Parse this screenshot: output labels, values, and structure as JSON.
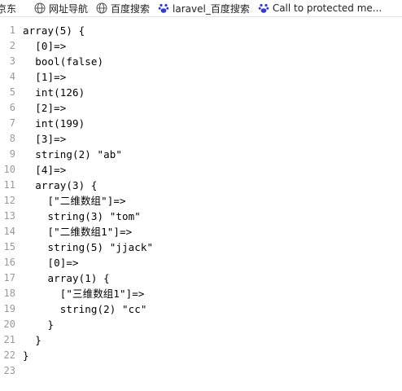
{
  "bookmarks": [
    {
      "label": "京东",
      "icon": "bookmark-icon"
    },
    {
      "label": "网址导航",
      "icon": "globe-icon"
    },
    {
      "label": "百度搜索",
      "icon": "globe-icon"
    },
    {
      "label": "laravel_百度搜索",
      "icon": "baidu-paw-icon"
    },
    {
      "label": "Call to protected me...",
      "icon": "baidu-paw-icon"
    }
  ],
  "code_lines": [
    {
      "n": "1",
      "text": "array(5) {"
    },
    {
      "n": "2",
      "text": "  [0]=>"
    },
    {
      "n": "3",
      "text": "  bool(false)"
    },
    {
      "n": "4",
      "text": "  [1]=>"
    },
    {
      "n": "5",
      "text": "  int(126)"
    },
    {
      "n": "6",
      "text": "  [2]=>"
    },
    {
      "n": "7",
      "text": "  int(199)"
    },
    {
      "n": "8",
      "text": "  [3]=>"
    },
    {
      "n": "9",
      "text": "  string(2) \"ab\""
    },
    {
      "n": "10",
      "text": "  [4]=>"
    },
    {
      "n": "11",
      "text": "  array(3) {"
    },
    {
      "n": "12",
      "text": "    [\"二维数组\"]=>"
    },
    {
      "n": "13",
      "text": "    string(3) \"tom\""
    },
    {
      "n": "14",
      "text": "    [\"二维数组1\"]=>"
    },
    {
      "n": "15",
      "text": "    string(5) \"jjack\""
    },
    {
      "n": "16",
      "text": "    [0]=>"
    },
    {
      "n": "17",
      "text": "    array(1) {"
    },
    {
      "n": "18",
      "text": "      [\"三维数组1\"]=>"
    },
    {
      "n": "19",
      "text": "      string(2) \"cc\""
    },
    {
      "n": "20",
      "text": "    }"
    },
    {
      "n": "21",
      "text": "  }"
    },
    {
      "n": "22",
      "text": "}"
    },
    {
      "n": "23",
      "text": ""
    }
  ],
  "colors": {
    "line_number": "#999999",
    "code_text": "#000000",
    "baidu_blue": "#2f3bd6"
  }
}
